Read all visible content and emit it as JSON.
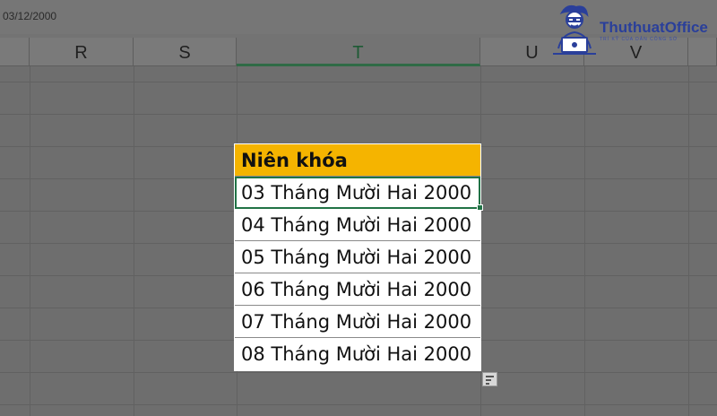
{
  "formula_bar": {
    "value": "03/12/2000"
  },
  "columns": [
    "R",
    "S",
    "T",
    "U",
    "V"
  ],
  "active_column": "T",
  "table": {
    "header": "Niên khóa",
    "rows": [
      "03 Tháng Mười Hai 2000",
      "04 Tháng Mười Hai 2000",
      "05 Tháng Mười Hai 2000",
      "06 Tháng Mười Hai 2000",
      "07 Tháng Mười Hai 2000",
      "08 Tháng Mười Hai 2000"
    ]
  },
  "logo": {
    "name": "ThuthuatOffice",
    "tagline": "TRÍ KỸ CỦA DÂN CÔNG SỞ"
  },
  "colors": {
    "header_fill": "#f5b400",
    "selection": "#217346",
    "logo": "#2a3f9a"
  },
  "icons": {
    "quick_analysis": "quick-analysis-icon"
  }
}
